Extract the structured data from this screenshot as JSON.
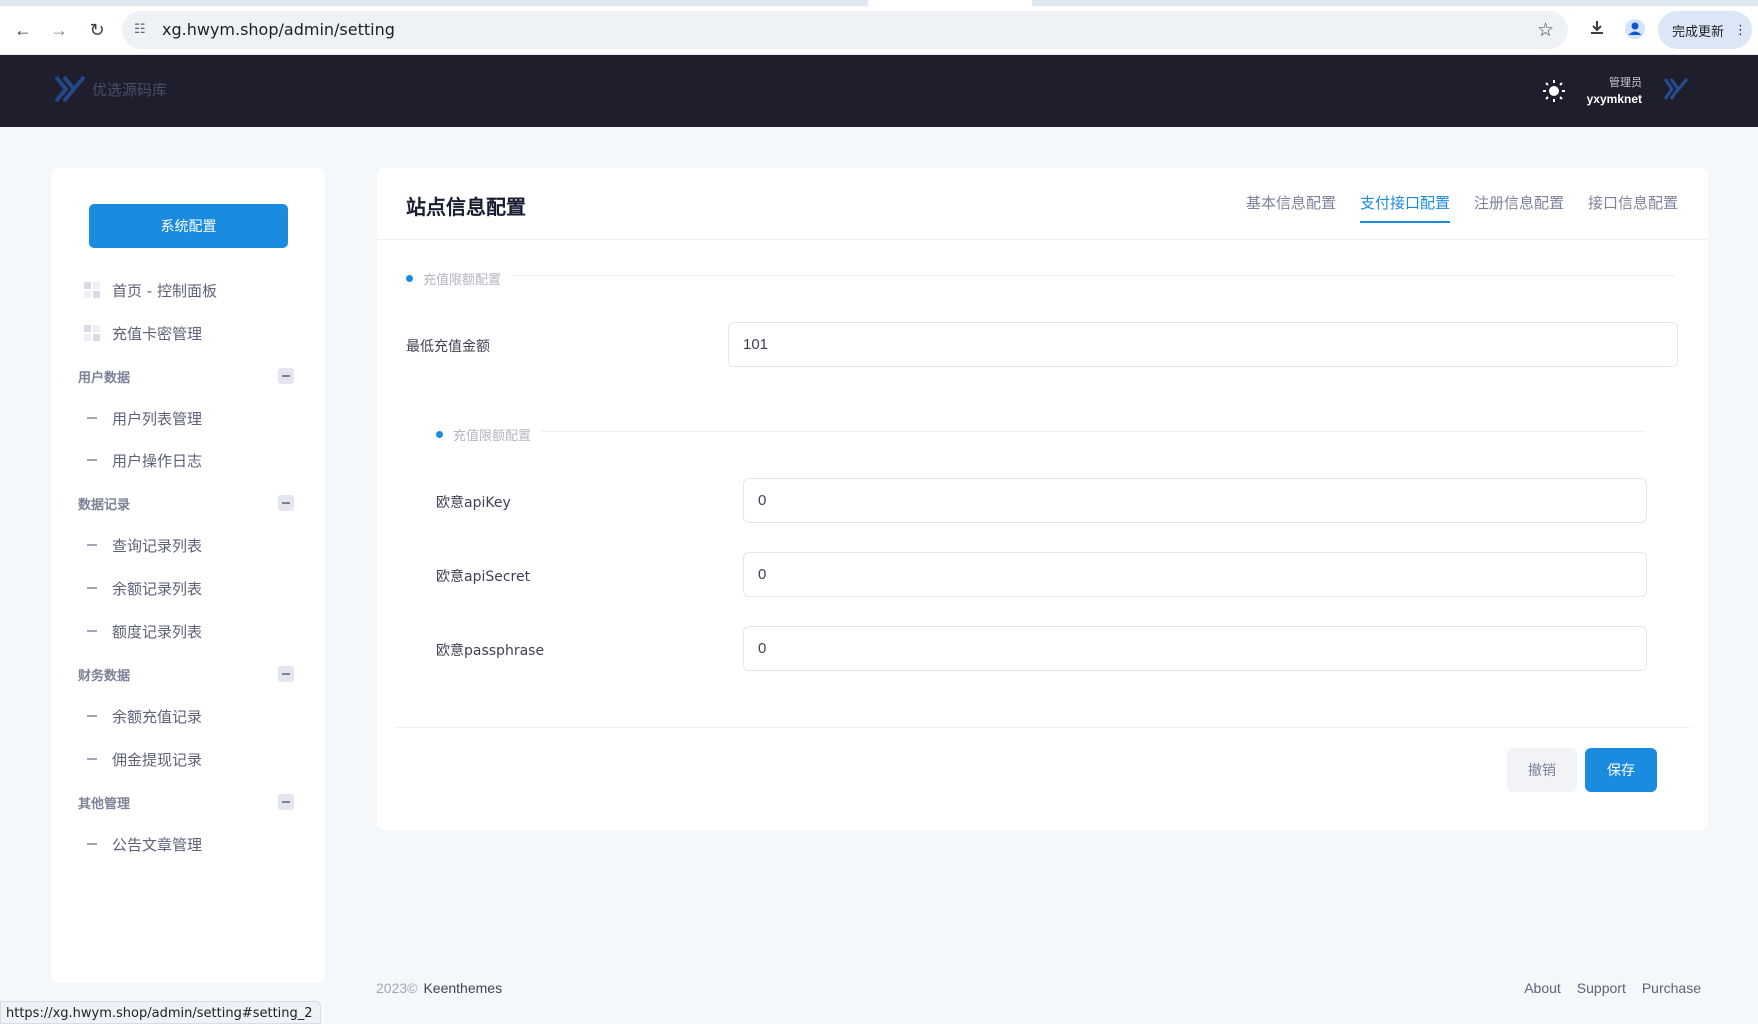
{
  "browser": {
    "url": "xg.hwym.shop/admin/setting",
    "update_label": "完成更新",
    "status_url": "https://xg.hwym.shop/admin/setting#setting_2"
  },
  "header": {
    "logo_text": "优选源码库",
    "user_role": "管理员",
    "user_name": "yxymknet"
  },
  "sidebar": {
    "system_button": "系统配置",
    "top_items": [
      {
        "label": "首页 - 控制面板",
        "icon": "dashboard-icon"
      },
      {
        "label": "充值卡密管理",
        "icon": "dashboard-icon"
      }
    ],
    "sections": [
      {
        "title": "用户数据",
        "items": [
          "用户列表管理",
          "用户操作日志"
        ]
      },
      {
        "title": "数据记录",
        "items": [
          "查询记录列表",
          "余额记录列表",
          "额度记录列表"
        ]
      },
      {
        "title": "财务数据",
        "items": [
          "余额充值记录",
          "佣金提现记录"
        ]
      },
      {
        "title": "其他管理",
        "items": [
          "公告文章管理"
        ]
      }
    ]
  },
  "main": {
    "title": "站点信息配置",
    "tabs": [
      "基本信息配置",
      "支付接口配置",
      "注册信息配置",
      "接口信息配置"
    ],
    "active_tab": 1,
    "section1_title": "充值限额配置",
    "min_recharge_label": "最低充值金额",
    "min_recharge_value": "101",
    "section2_title": "充值限额配置",
    "fields": [
      {
        "label": "欧意apiKey",
        "value": "0"
      },
      {
        "label": "欧意apiSecret",
        "value": "0"
      },
      {
        "label": "欧意passphrase",
        "value": "0"
      }
    ],
    "cancel_label": "撤销",
    "save_label": "保存"
  },
  "footer": {
    "copyright": "2023©",
    "brand": "Keenthemes",
    "links": [
      "About",
      "Support",
      "Purchase"
    ]
  },
  "colors": {
    "accent": "#1b8be0",
    "header_bg": "#1e1e2d",
    "page_bg": "#f5f8fa"
  }
}
